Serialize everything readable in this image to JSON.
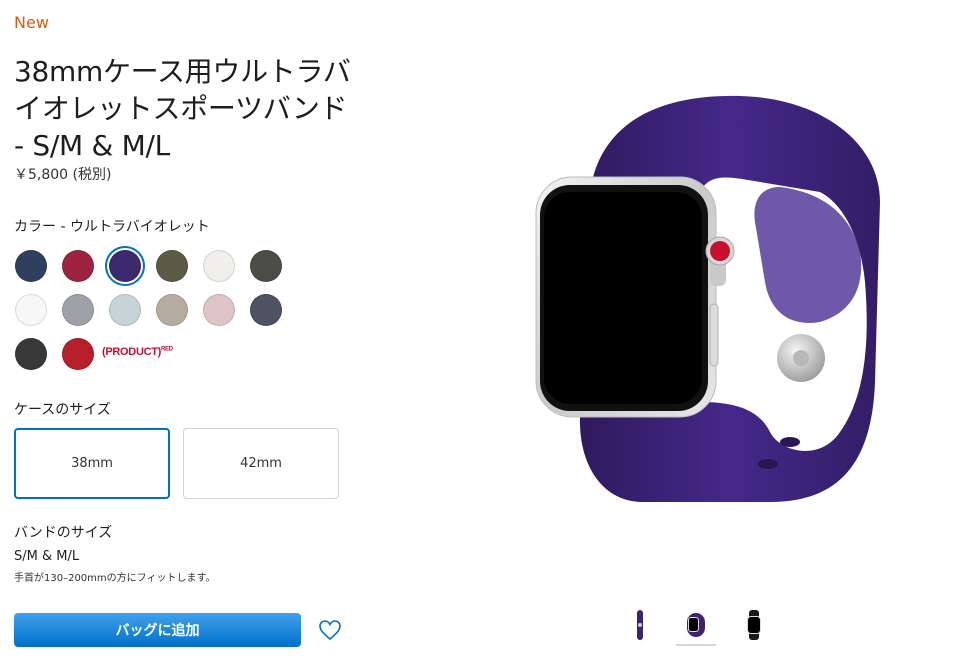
{
  "badge": "New",
  "product": {
    "title": "38mmケース用ウルトラバイオレットスポーツバンド - S/M & M/L",
    "price": "￥5,800 (税別)"
  },
  "color": {
    "label": "カラー - ウルトラバイオレット",
    "swatches": [
      {
        "name": "midnight-blue",
        "hex": "#2f3f5e"
      },
      {
        "name": "berry",
        "hex": "#9c2440"
      },
      {
        "name": "ultra-violet",
        "hex": "#3d2a6e",
        "selected": true
      },
      {
        "name": "dark-olive",
        "hex": "#5b5a45"
      },
      {
        "name": "soft-white",
        "hex": "#f1efec"
      },
      {
        "name": "charcoal-gray",
        "hex": "#4d4d48"
      },
      {
        "name": "white",
        "hex": "#f7f7f7"
      },
      {
        "name": "gray",
        "hex": "#9ea1a8"
      },
      {
        "name": "light-blue-gray",
        "hex": "#c6d3d7"
      },
      {
        "name": "taupe",
        "hex": "#b5aba1"
      },
      {
        "name": "pink-sand",
        "hex": "#ddc4c5"
      },
      {
        "name": "dark-slate",
        "hex": "#4e5263"
      },
      {
        "name": "black",
        "hex": "#383838"
      },
      {
        "name": "red",
        "hex": "#b5202b"
      }
    ],
    "product_red": "(PRODUCT)",
    "product_red_sup": "RED"
  },
  "case": {
    "label": "ケースのサイズ",
    "options": [
      "38mm",
      "42mm"
    ],
    "selected_index": 0
  },
  "band": {
    "label": "バンドのサイズ",
    "size": "S/M & M/L",
    "note": "手首が130–200mmの方にフィットします。"
  },
  "actions": {
    "add_to_bag": "バッグに追加"
  },
  "colors": {
    "band": "#3d2270",
    "accent": "#0070c9",
    "badge": "#e25a0e"
  }
}
